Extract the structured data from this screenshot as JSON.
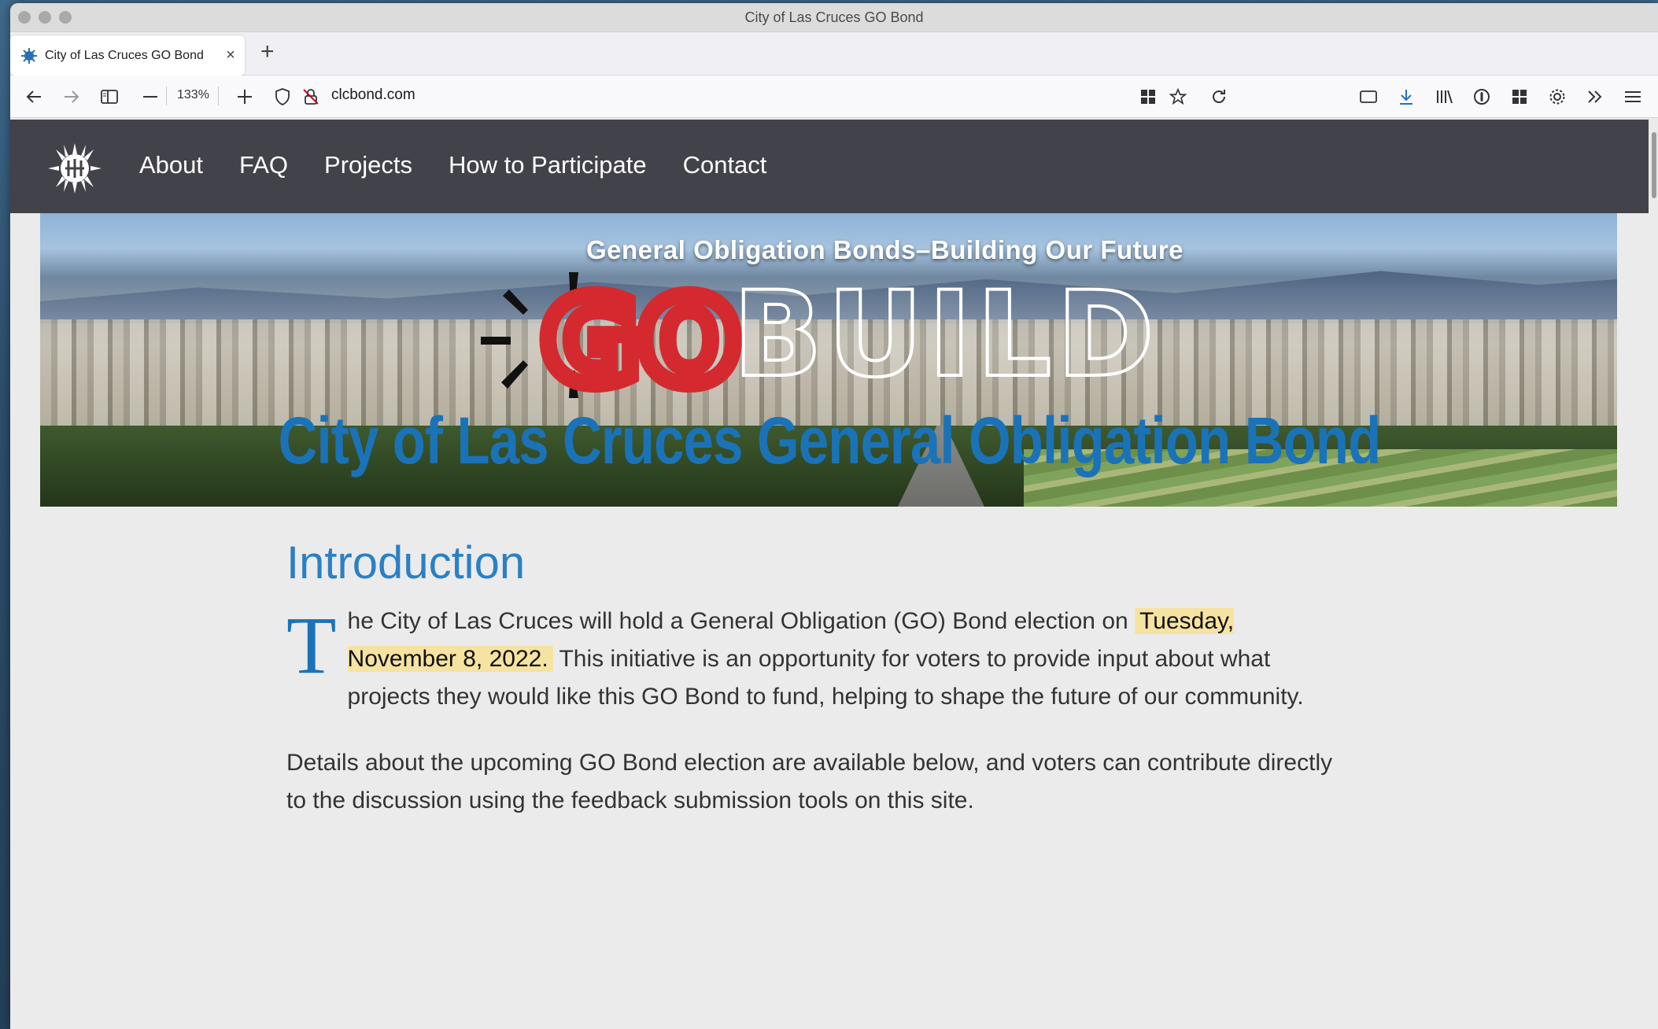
{
  "window": {
    "title": "City of Las Cruces GO Bond"
  },
  "tab": {
    "title": "City of Las Cruces GO Bond",
    "close": "×",
    "new_tab": "+"
  },
  "toolbar": {
    "zoom": "133%",
    "url": "clcbond.com"
  },
  "site_nav": {
    "links": [
      "About",
      "FAQ",
      "Projects",
      "How to Participate",
      "Contact"
    ]
  },
  "hero": {
    "subtitle": "General Obligation Bonds–Building Our Future",
    "logo_go": "GO",
    "logo_build": "BUILD"
  },
  "content": {
    "title": "City of Las Cruces General Obligation Bond",
    "intro_heading": "Introduction",
    "para1_dropcap": "T",
    "para1_start": "he City of Las Cruces will hold a General Obligation (GO) Bond election on ",
    "para1_date": "Tuesday, November 8, 2022.",
    "para1_end": " This initiative is an opportunity for voters to provide input about what projects they would like this GO Bond to fund, helping to shape the future of our community.",
    "para2": "Details about the upcoming GO Bond election are available below, and voters can contribute directly to the discussion using the feedback submission tools on this site."
  },
  "colors": {
    "nav_bg": "#42424a",
    "title_blue": "#1a73b8",
    "highlight": "#f6e3a1",
    "go_red": "#d42a2f"
  }
}
